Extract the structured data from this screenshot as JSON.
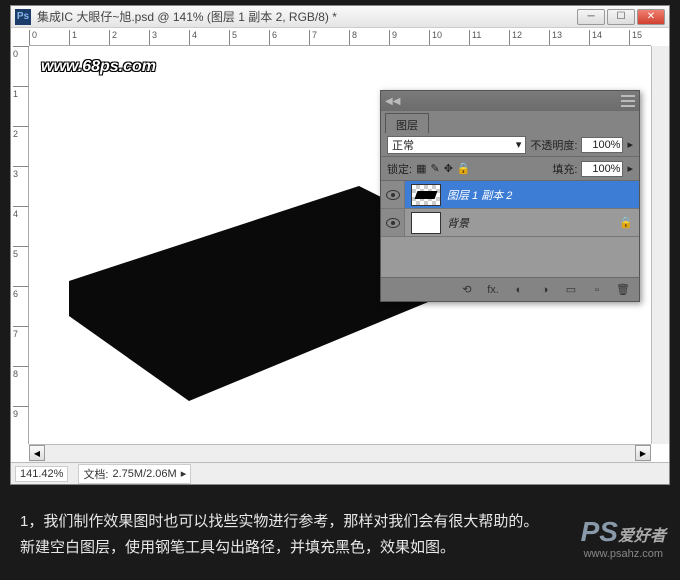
{
  "titlebar": {
    "app_icon": "Ps",
    "title": "集成IC    大眼仔~旭.psd @ 141% (图层 1 副本 2, RGB/8) *"
  },
  "ruler_h": [
    "0",
    "1",
    "2",
    "3",
    "4",
    "5",
    "6",
    "7",
    "8",
    "9",
    "10",
    "11",
    "12",
    "13",
    "14",
    "15"
  ],
  "ruler_v": [
    "0",
    "1",
    "2",
    "3",
    "4",
    "5",
    "6",
    "7",
    "8",
    "9"
  ],
  "canvas": {
    "watermark": "www.68ps.com"
  },
  "statusbar": {
    "zoom": "141.42%",
    "doc_label": "文档:",
    "doc_size": "2.75M/2.06M"
  },
  "layers_panel": {
    "tab": "图层",
    "blend_mode": "正常",
    "opacity_label": "不透明度:",
    "opacity_value": "100%",
    "lock_label": "锁定:",
    "fill_label": "填充:",
    "fill_value": "100%",
    "layers": [
      {
        "name": "图层 1 副本 2",
        "selected": true,
        "thumb": "shape"
      },
      {
        "name": "背景",
        "selected": false,
        "thumb": "white"
      }
    ],
    "footer_icons": {
      "link": "⟲",
      "fx": "fx.",
      "mask": "◐",
      "adjust": "◑",
      "folder": "▭",
      "new": "▫",
      "trash": "🗑"
    }
  },
  "caption": {
    "line1": "1，我们制作效果图时也可以找些实物进行参考，那样对我们会有很大帮助的。",
    "line2": "新建空白图层，使用钢笔工具勾出路径，并填充黑色，效果如图。"
  },
  "logo": {
    "badge": "PS",
    "cn": "爱好者",
    "url": "www.psahz.com"
  }
}
